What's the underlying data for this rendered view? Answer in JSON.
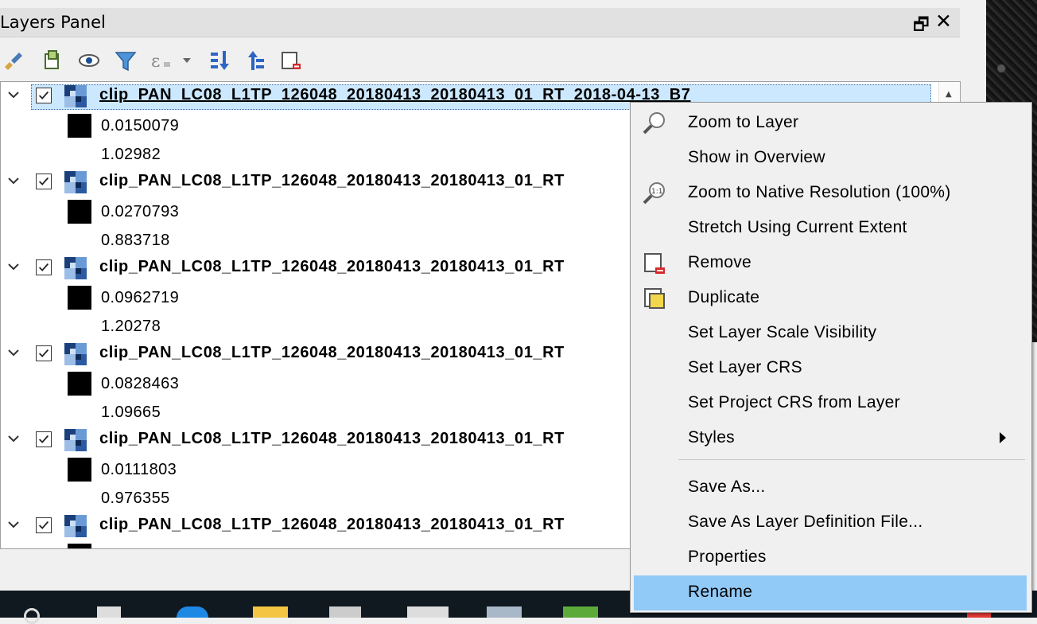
{
  "panel": {
    "title": "Layers Panel",
    "float_label": "🗗",
    "close_label": "✕"
  },
  "toolbar": {
    "icons": [
      "style-paintbrush-icon",
      "add-group-icon",
      "visibility-eye-icon",
      "filter-funnel-icon",
      "filter-expression-icon",
      "expand-all-icon",
      "collapse-all-icon",
      "remove-layer-icon"
    ]
  },
  "layers": [
    {
      "name": "clip_PAN_LC08_L1TP_126048_20180413_20180413_01_RT_2018-04-13_B7",
      "legend_min": "0.0150079",
      "legend_max": "1.02982",
      "checked": true,
      "selected": true
    },
    {
      "name": "clip_PAN_LC08_L1TP_126048_20180413_20180413_01_RT",
      "legend_min": "0.0270793",
      "legend_max": "0.883718",
      "checked": true,
      "selected": false
    },
    {
      "name": "clip_PAN_LC08_L1TP_126048_20180413_20180413_01_RT",
      "legend_min": "0.0962719",
      "legend_max": "1.20278",
      "checked": true,
      "selected": false
    },
    {
      "name": "clip_PAN_LC08_L1TP_126048_20180413_20180413_01_RT",
      "legend_min": "0.0828463",
      "legend_max": "1.09665",
      "checked": true,
      "selected": false
    },
    {
      "name": "clip_PAN_LC08_L1TP_126048_20180413_20180413_01_RT",
      "legend_min": "0.0111803",
      "legend_max": "0.976355",
      "checked": true,
      "selected": false
    },
    {
      "name": "clip_PAN_LC08_L1TP_126048_20180413_20180413_01_RT",
      "legend_min": "",
      "legend_max": "",
      "checked": true,
      "selected": false
    }
  ],
  "context_menu": {
    "items": [
      {
        "label": "Zoom to Layer",
        "icon": "zoom-to-layer-icon"
      },
      {
        "label": "Show in Overview",
        "icon": ""
      },
      {
        "label": "Zoom to Native Resolution (100%)",
        "icon": "zoom-native-icon"
      },
      {
        "label": "Stretch Using Current Extent",
        "icon": ""
      },
      {
        "label": "Remove",
        "icon": "remove-layer-icon"
      },
      {
        "label": "Duplicate",
        "icon": "duplicate-layer-icon"
      },
      {
        "label": "Set Layer Scale Visibility",
        "icon": ""
      },
      {
        "label": "Set Layer CRS",
        "icon": ""
      },
      {
        "label": "Set Project CRS from Layer",
        "icon": ""
      },
      {
        "label": "Styles",
        "icon": "",
        "submenu": true
      },
      {
        "label": "Save As...",
        "icon": ""
      },
      {
        "label": "Save As Layer Definition File...",
        "icon": ""
      },
      {
        "label": "Properties",
        "icon": ""
      },
      {
        "label": "Rename",
        "icon": "",
        "hover": true
      }
    ]
  },
  "colors": {
    "selection": "#cce8ff",
    "menu_hover": "#91c9f7",
    "taskbar": "#101820"
  }
}
